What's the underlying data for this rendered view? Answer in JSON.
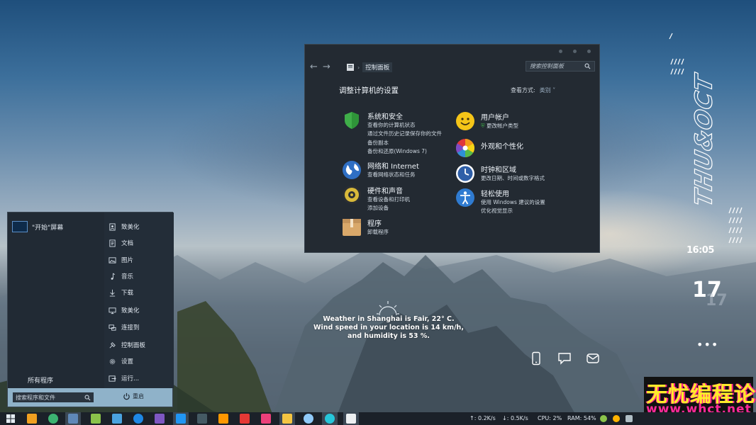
{
  "start_menu": {
    "start_screen_label": "\"开始\"屏幕",
    "all_programs": "所有程序",
    "right_items": [
      {
        "label": "致美化",
        "icon": "user-doc-icon"
      },
      {
        "label": "文档",
        "icon": "document-icon"
      },
      {
        "label": "图片",
        "icon": "picture-icon"
      },
      {
        "label": "音乐",
        "icon": "music-note-icon"
      },
      {
        "label": "下载",
        "icon": "download-icon"
      },
      {
        "label": "致美化",
        "icon": "computer-icon"
      },
      {
        "label": "连接到",
        "icon": "connect-icon"
      },
      {
        "label": "控制面板",
        "icon": "control-panel-icon"
      },
      {
        "label": "设置",
        "icon": "settings-gear-icon"
      },
      {
        "label": "运行...",
        "icon": "run-icon"
      }
    ],
    "search_placeholder": "搜索程序和文件",
    "power_label": "重启"
  },
  "control_panel": {
    "breadcrumb": "控制面板",
    "search_placeholder": "搜索控制面板",
    "heading": "调整计算机的设置",
    "view_by_label": "查看方式:",
    "view_by_value": "类别 ˅",
    "categories_left": [
      {
        "title": "系统和安全",
        "icon": "shield-icon",
        "links": [
          "查看你的计算机状态",
          "通过文件历史记录保存你的文件",
          "备份副本",
          "备份和还原(Windows 7)"
        ]
      },
      {
        "title": "网络和 Internet",
        "icon": "globe-icon",
        "links": [
          "查看网络状态和任务"
        ]
      },
      {
        "title": "硬件和声音",
        "icon": "speaker-icon",
        "links": [
          "查看设备和打印机",
          "添加设备"
        ]
      },
      {
        "title": "程序",
        "icon": "box-icon",
        "links": [
          "卸载程序"
        ]
      }
    ],
    "categories_right": [
      {
        "title": "用户帐户",
        "icon": "smiley-user-icon",
        "links": [
          "更改帐户类型"
        ]
      },
      {
        "title": "外观和个性化",
        "icon": "color-wheel-icon",
        "links": []
      },
      {
        "title": "时钟和区域",
        "icon": "clock-icon",
        "links": [
          "更改日期、时间或数字格式"
        ]
      },
      {
        "title": "轻松使用",
        "icon": "accessibility-icon",
        "links": [
          "使用 Windows 建议的设置",
          "优化视觉显示"
        ]
      }
    ]
  },
  "weather": {
    "line1": "Weather in Shanghai is Fair, 22° C.",
    "line2": "Wind speed in your location is 14 km/h,",
    "line3": "and humidity is 53 %."
  },
  "clock_widget": {
    "day_month": "THU&OCT",
    "time": "16:05",
    "day_number": "17",
    "more": "•••"
  },
  "quick_icons": [
    "phone-icon",
    "chat-bubble-icon",
    "mail-icon"
  ],
  "watermark": {
    "line1": "无忧编程论坛",
    "line2": "www.whct.net"
  },
  "taskbar": {
    "upload": "↑: 0.2K/s",
    "download": "↓: 0.5K/s",
    "cpu": "CPU: 2%",
    "ram": "RAM: 54%"
  },
  "colors": {
    "window_bg": "#232a32",
    "start_bg": "#212a34",
    "start_footer": "#8fb2c9",
    "taskbar_bg": "#1b2129",
    "watermark_yellow": "#ffeb2a",
    "watermark_pink": "#ff2a9a"
  }
}
